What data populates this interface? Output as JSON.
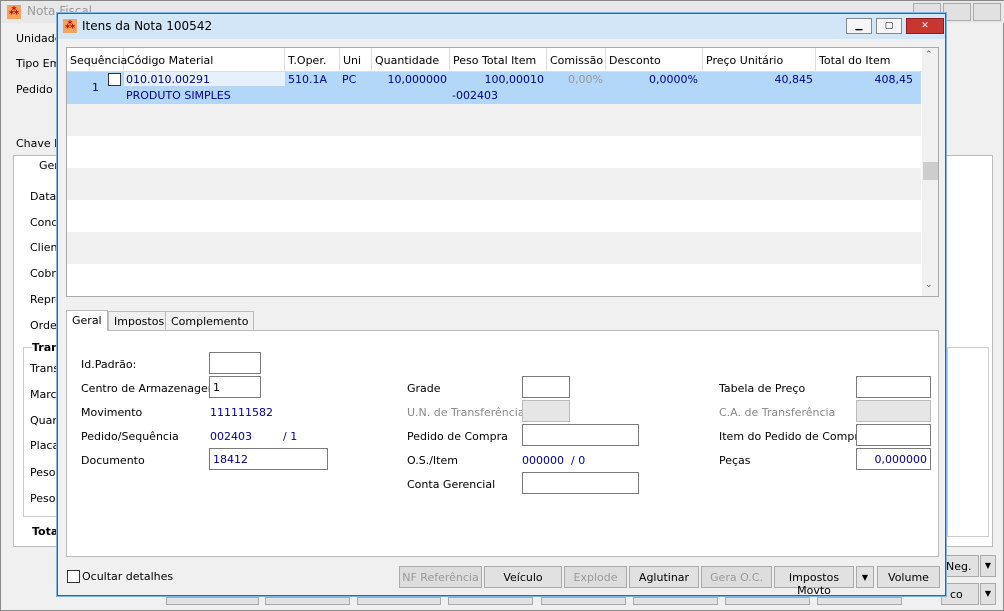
{
  "outer": {
    "title": "Nota Fiscal",
    "labels": [
      "Unidade",
      "Tipo Emis",
      "Pedido",
      "Chave N",
      "Ger",
      "Data",
      "Condi",
      "Client",
      "Cobra",
      "Repre",
      "Order",
      "Tran",
      "Trans",
      "Marca",
      "Quan",
      "Placa",
      "Peso",
      "Peso",
      "Tota"
    ],
    "btn_neg": "Neg.",
    "btn_co": "co"
  },
  "dialog": {
    "title": "Itens da Nota 100542"
  },
  "grid": {
    "columns": [
      "Sequência",
      "Código Material",
      "T.Oper.",
      "Uni",
      "Quantidade",
      "Peso Total Item",
      "Comissão",
      "Desconto",
      "Preço Unitário",
      "Total do Item"
    ],
    "row": {
      "seq": "1",
      "codigo": "010.010.00291",
      "descricao": "PRODUTO SIMPLES",
      "toper": "510.1A",
      "uni": "PC",
      "quantidade": "10,000000",
      "peso": "100,00010",
      "peso2": "-002403",
      "comissao": "0,00%",
      "desconto": "0,0000%",
      "preco": "40,845",
      "total": "408,45"
    }
  },
  "tabs": [
    "Geral",
    "Impostos",
    "Complemento"
  ],
  "form": {
    "id_padrao": {
      "label": "Id.Padrão:",
      "value": ""
    },
    "centro": {
      "label": "Centro de Armazenagem",
      "value": "1"
    },
    "movimento": {
      "label": "Movimento",
      "value": "111111582"
    },
    "pedido_seq": {
      "label": "Pedido/Sequência",
      "pedido": "002403",
      "seq": "/ 1"
    },
    "documento": {
      "label": "Documento",
      "value": "18412"
    },
    "grade": {
      "label": "Grade",
      "value": ""
    },
    "un_transf": {
      "label": "U.N. de Transferência",
      "value": ""
    },
    "pedido_compra": {
      "label": "Pedido de Compra",
      "value": ""
    },
    "os_item": {
      "label": "O.S./Item",
      "os": "000000",
      "item": "/ 0"
    },
    "conta": {
      "label": "Conta Gerencial",
      "value": ""
    },
    "tabela": {
      "label": "Tabela de Preço",
      "value": ""
    },
    "ca_transf": {
      "label": "C.A. de Transferência",
      "value": ""
    },
    "item_pedido": {
      "label": "Item do Pedido de Compra",
      "value": ""
    },
    "pecas": {
      "label": "Peças",
      "value": "0,000000"
    }
  },
  "footer": {
    "ocultar": "Ocultar detalhes",
    "buttons": [
      "NF Referência",
      "Veículo",
      "Explode",
      "Aglutinar",
      "Gera O.C.",
      "Impostos Movto",
      "Volume"
    ]
  }
}
